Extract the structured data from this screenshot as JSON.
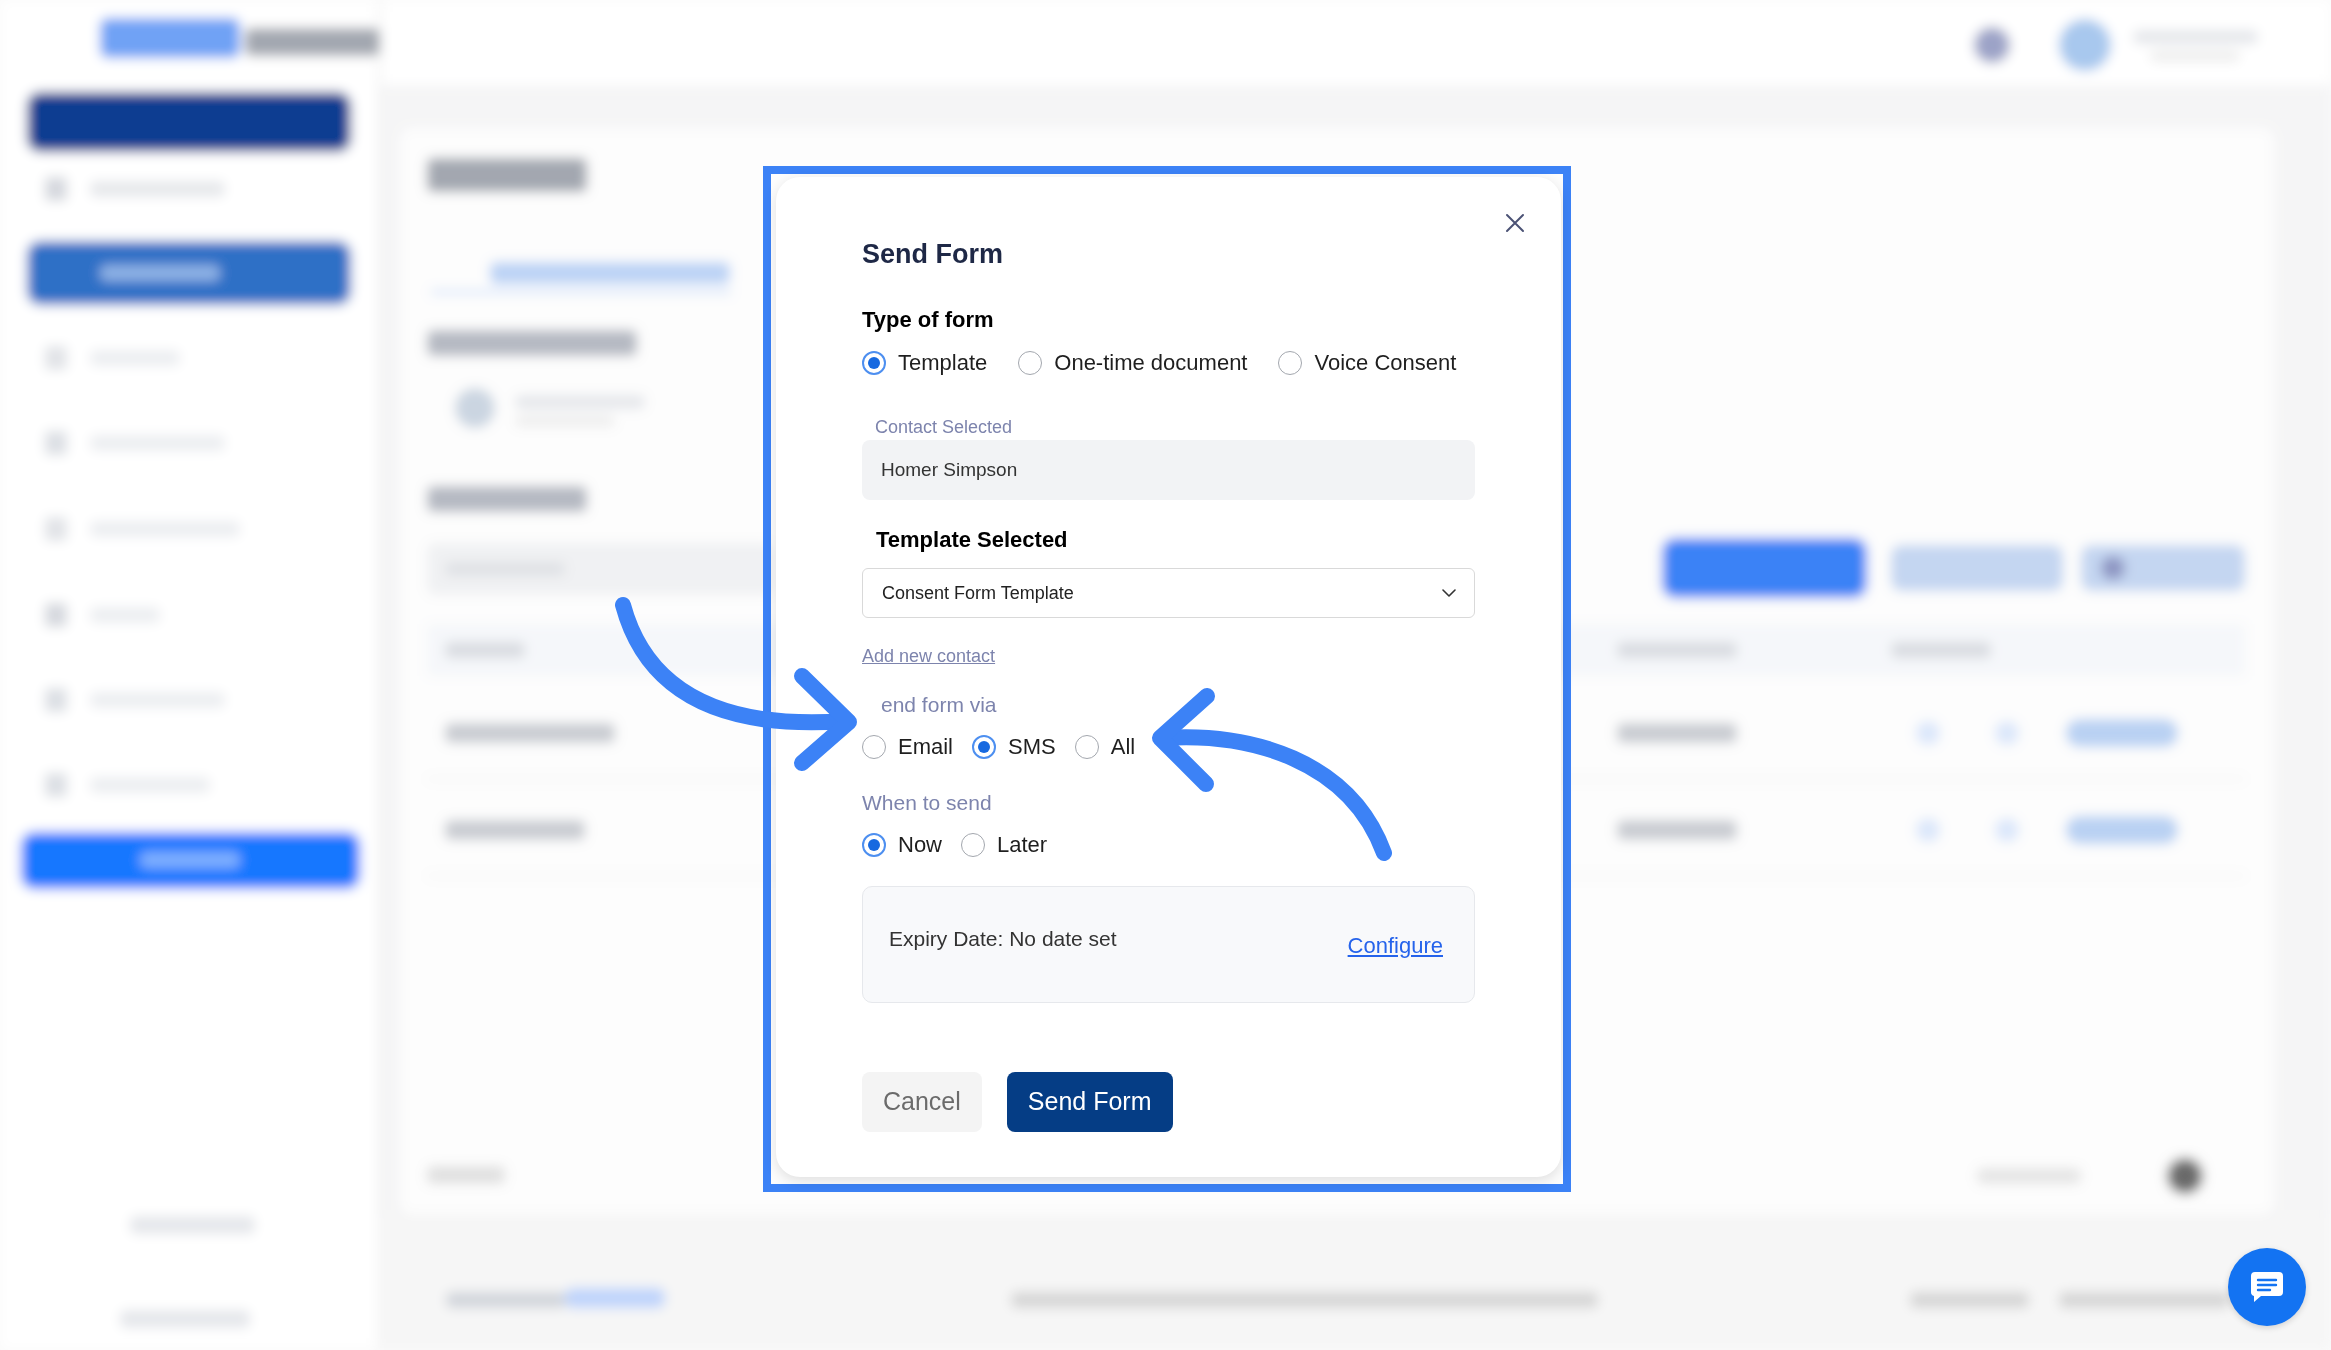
{
  "dialog": {
    "title": "Send Form"
  },
  "form_type": {
    "label": "Type of form",
    "options": [
      {
        "label": "Template",
        "selected": true
      },
      {
        "label": "One-time document",
        "selected": false
      },
      {
        "label": "Voice Consent",
        "selected": false
      }
    ]
  },
  "contact": {
    "label": "Contact Selected",
    "value": "Homer Simpson"
  },
  "template": {
    "label": "Template Selected",
    "value": "Consent Form Template"
  },
  "add_contact": {
    "label": "Add new contact"
  },
  "send_via": {
    "label": "end form via",
    "options": [
      {
        "label": "Email",
        "selected": false
      },
      {
        "label": "SMS",
        "selected": true
      },
      {
        "label": "All",
        "selected": false
      }
    ]
  },
  "when_to_send": {
    "label": "When to send",
    "options": [
      {
        "label": "Now",
        "selected": true
      },
      {
        "label": "Later",
        "selected": false
      }
    ]
  },
  "expiry": {
    "text": "Expiry Date: No date set",
    "action": "Configure"
  },
  "buttons": [
    {
      "label": "Cancel",
      "kind": "secondary"
    },
    {
      "label": "Send Form",
      "kind": "primary"
    }
  ]
}
